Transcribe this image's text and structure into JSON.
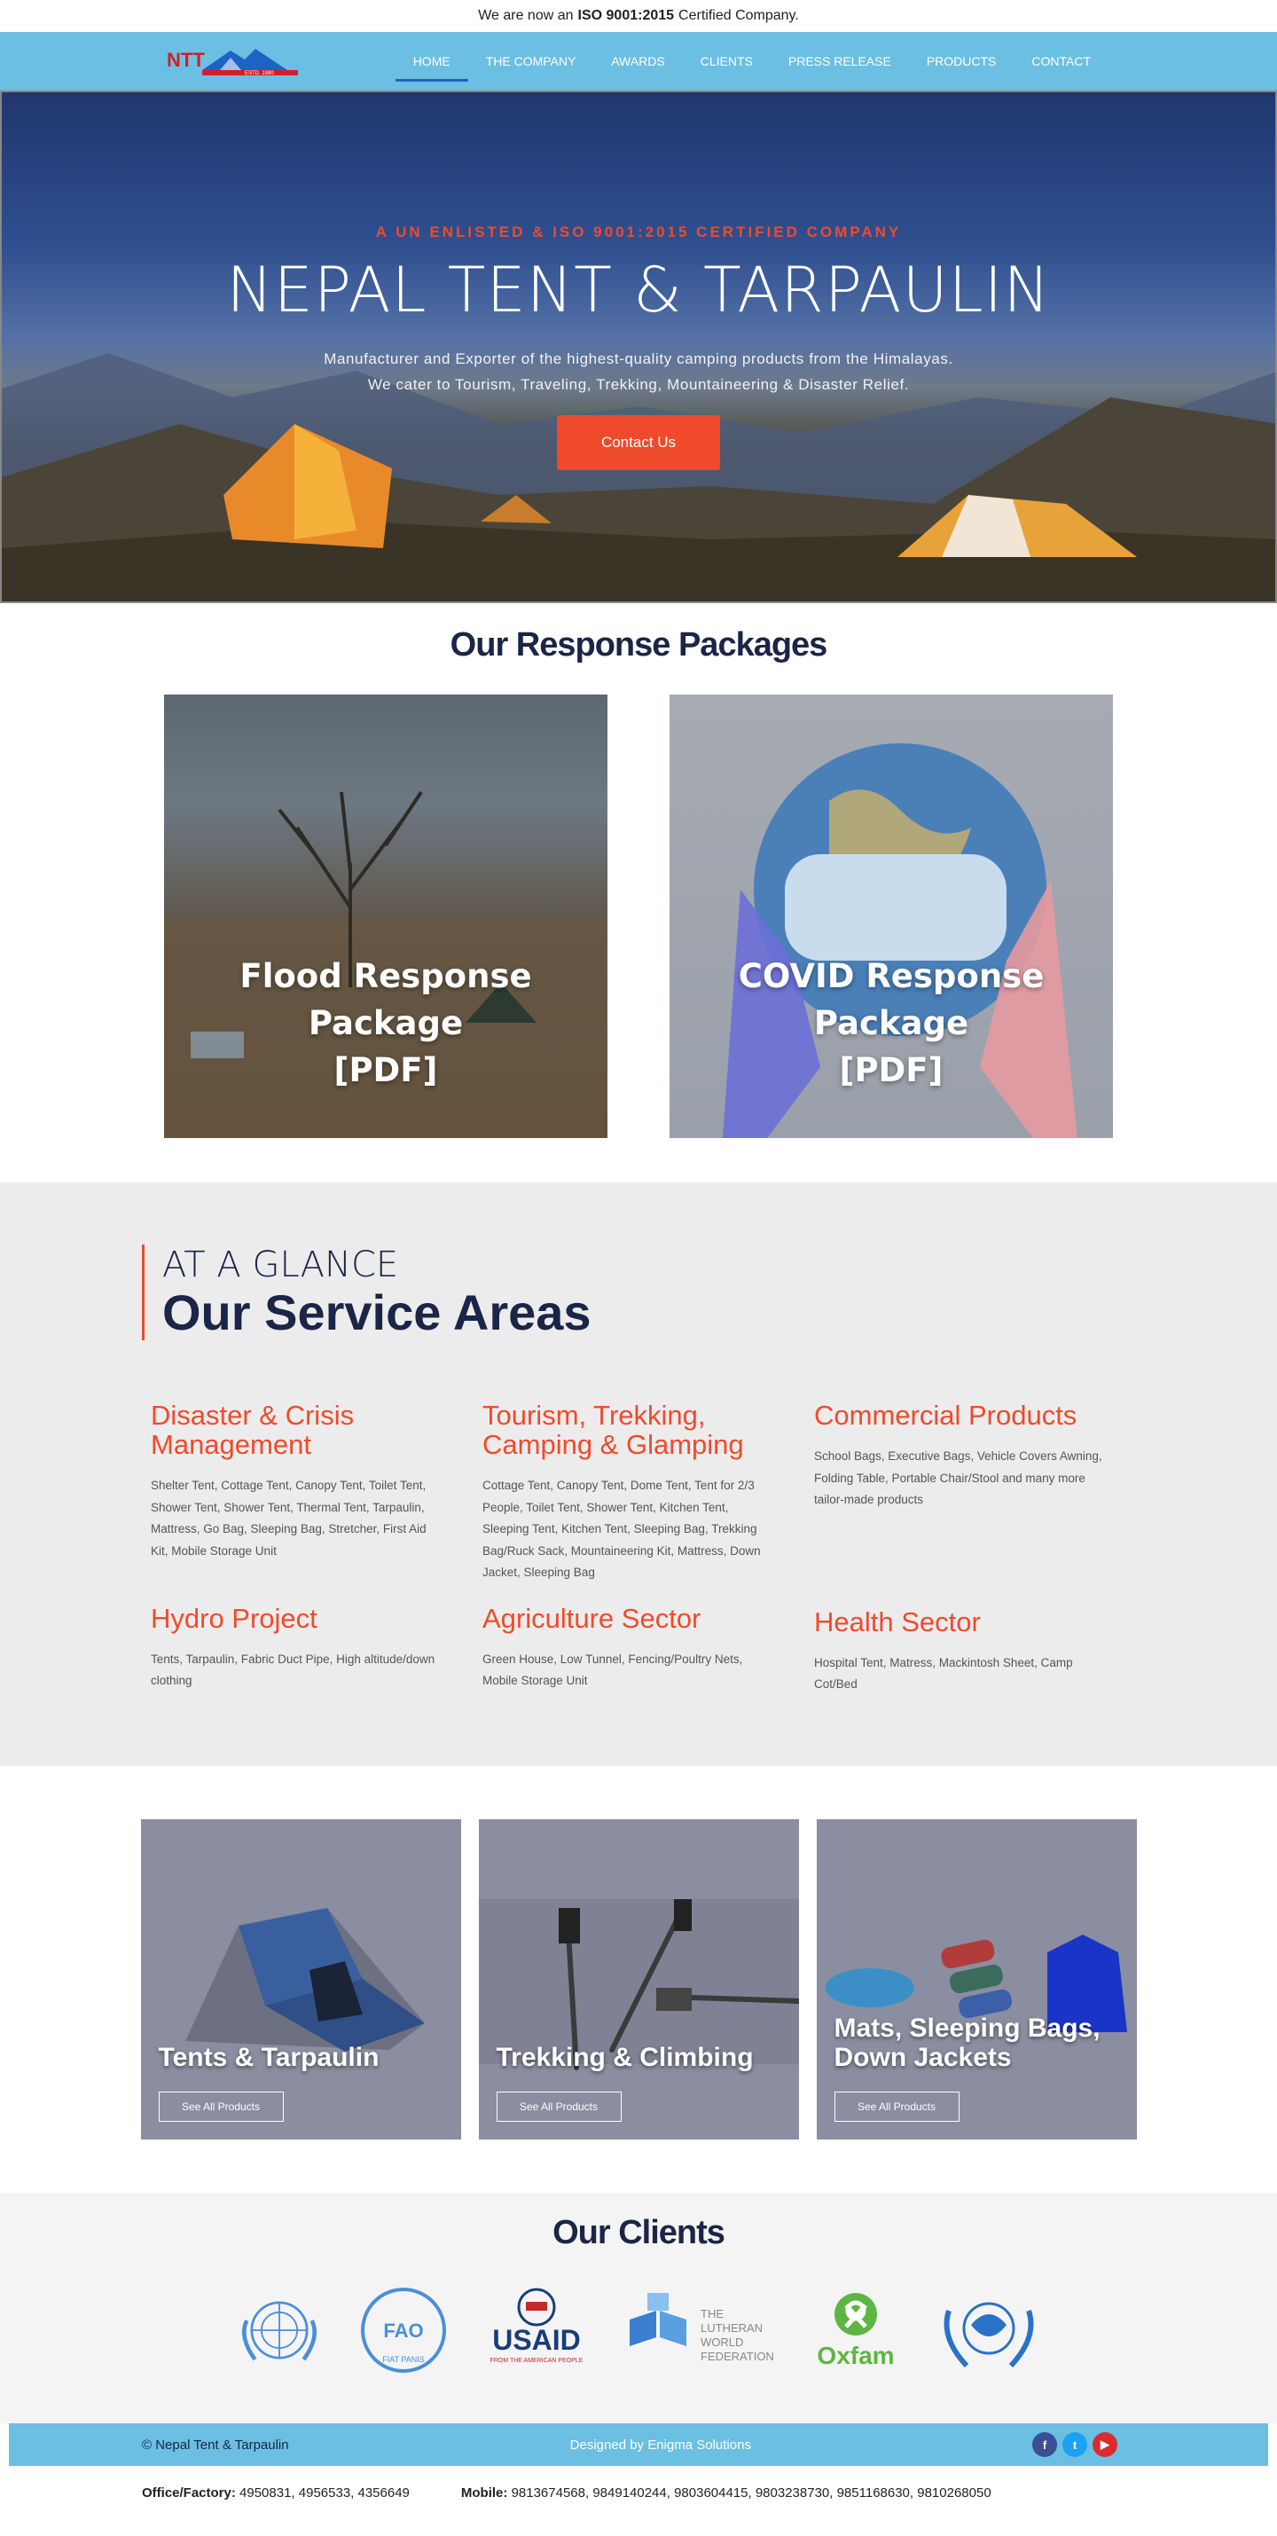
{
  "notice": {
    "pre": "We are now an",
    "bold": "ISO 9001:2015",
    "post": "Certified Company."
  },
  "logo": {
    "text": "NTT",
    "sub": "ESTD. 1980"
  },
  "nav": {
    "items": [
      "HOME",
      "THE COMPANY",
      "AWARDS",
      "CLIENTS",
      "PRESS RELEASE",
      "PRODUCTS",
      "CONTACT"
    ],
    "active": "HOME"
  },
  "hero": {
    "kicker": "A UN ENLISTED & ISO 9001:2015 CERTIFIED COMPANY",
    "title": "NEPAL TENT & TARPAULIN",
    "sub1": "Manufacturer and Exporter of the highest-quality camping products from the Himalayas.",
    "sub2": "We cater to Tourism, Traveling, Trekking, Mountaineering & Disaster Relief.",
    "cta": "Contact Us"
  },
  "packages": {
    "heading": "Our Response Packages",
    "items": [
      {
        "line1": "Flood Response Package",
        "line2": "[PDF]"
      },
      {
        "line1": "COVID Response Package",
        "line2": "[PDF]"
      }
    ]
  },
  "services": {
    "kicker": "AT A GLANCE",
    "title": "Our Service Areas",
    "areas": [
      {
        "title": "Disaster & Crisis Management",
        "desc": "Shelter Tent, Cottage Tent, Canopy Tent, Toilet Tent, Shower Tent, Shower Tent, Thermal Tent, Tarpaulin, Mattress, Go Bag, Sleeping Bag, Stretcher, First Aid Kit, Mobile Storage Unit"
      },
      {
        "title": "Tourism, Trekking, Camping & Glamping",
        "desc": "Cottage Tent, Canopy Tent, Dome Tent, Tent for 2/3 People, Toilet Tent, Shower Tent, Kitchen Tent, Sleeping Tent, Kitchen Tent, Sleeping Bag, Trekking Bag/Ruck Sack, Mountaineering Kit, Mattress, Down Jacket, Sleeping Bag"
      },
      {
        "title": "Commercial Products",
        "desc": "School Bags, Executive Bags, Vehicle Covers Awning, Folding Table, Portable Chair/Stool and many more tailor-made products"
      },
      {
        "title": "Hydro Project",
        "desc": "Tents, Tarpaulin, Fabric Duct Pipe, High altitude/down clothing"
      },
      {
        "title": "Agriculture Sector",
        "desc": "Green House, Low Tunnel, Fencing/Poultry Nets, Mobile Storage Unit"
      },
      {
        "title": "Health Sector",
        "desc": "Hospital Tent, Matress, Mackintosh Sheet, Camp Cot/Bed"
      }
    ]
  },
  "products": {
    "button": "See All Products",
    "items": [
      {
        "title": "Tents & Tarpaulin"
      },
      {
        "title": "Trekking & Climbing"
      },
      {
        "title": "Mats, Sleeping Bags, Down Jackets"
      }
    ]
  },
  "clients": {
    "heading": "Our Clients",
    "logos": [
      {
        "icon": "un-logo-icon"
      },
      {
        "icon": "fao-logo-icon",
        "text": "FAO",
        "motto": "FIAT PANIS"
      },
      {
        "icon": "usaid-logo-icon",
        "text": "USAID",
        "tagline": "FROM THE AMERICAN PEOPLE"
      },
      {
        "icon": "lwf-logo-icon",
        "line1": "THE",
        "line2": "LUTHERAN",
        "line3": "WORLD",
        "line4": "FEDERATION"
      },
      {
        "icon": "oxfam-logo-icon",
        "text": "Oxfam"
      },
      {
        "icon": "wfp-logo-icon"
      }
    ]
  },
  "footer": {
    "copyright": "© Nepal Tent & Tarpaulin",
    "designed": "Designed by Enigma Solutions",
    "office_label": "Office/Factory:",
    "office": "4950831, 4956533, 4356649",
    "mobile_label": "Mobile:",
    "mobile": "9813674568, 9849140244, 9803604415, 9803238730, 9851168630, 9810268050",
    "social_icons": [
      "facebook-icon",
      "twitter-icon",
      "youtube-icon"
    ]
  },
  "colors": {
    "accent": "#f04a2c",
    "nav": "#6bbfe2",
    "heading": "#1a2547"
  }
}
